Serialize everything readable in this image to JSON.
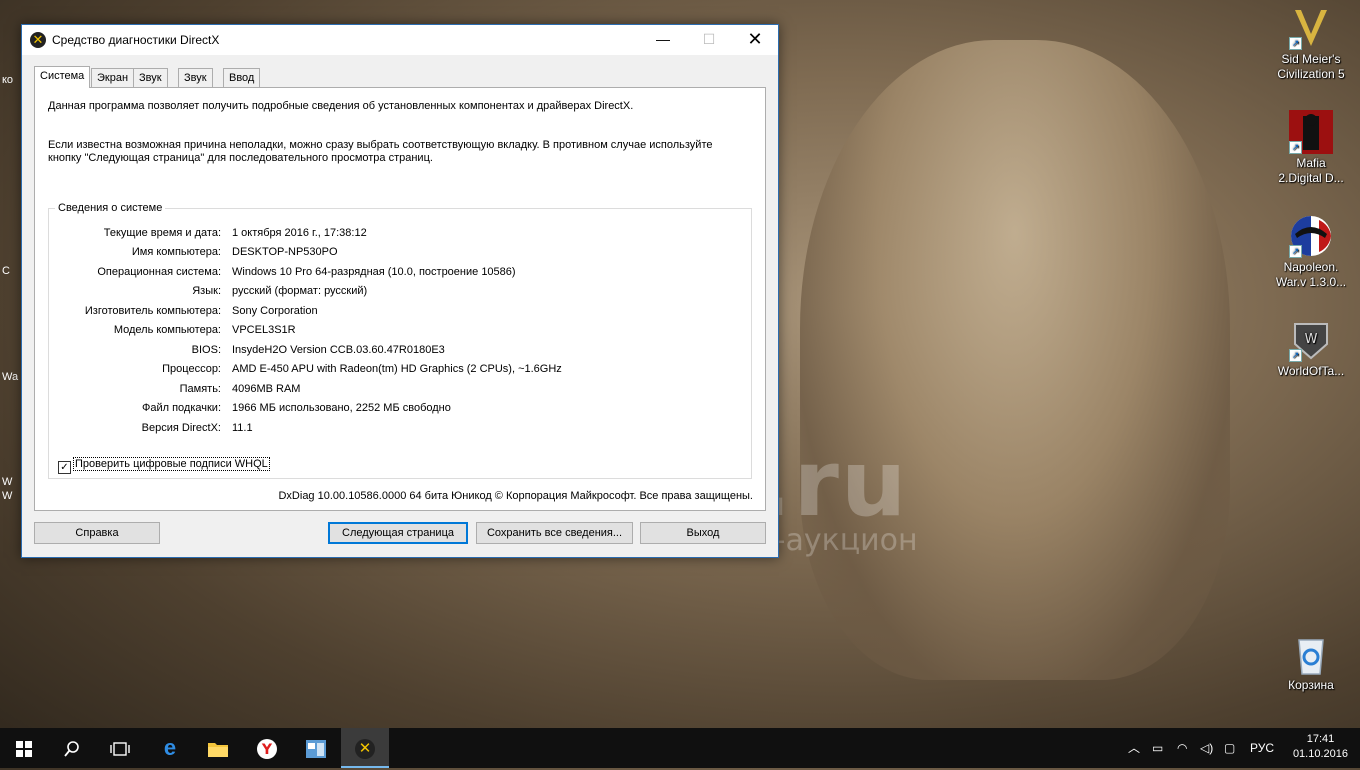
{
  "window": {
    "title": "Средство диагностики DirectX",
    "tabs": [
      "Система",
      "Экран",
      "Звук 1",
      "Звук 2",
      "Ввод"
    ],
    "active_tab": "Система",
    "intro_1": "Данная программа позволяет получить подробные сведения об установленных компонентах и драйверах DirectX.",
    "intro_2_line1": "Если известна возможная причина неполадки, можно сразу выбрать соответствующую вкладку. В противном случае используйте",
    "intro_2_line2": "кнопку \"Следующая страница\" для последовательного просмотра страниц.",
    "group_title": "Сведения о системе",
    "info": [
      {
        "label": "Текущие время и дата:",
        "value": "1 октября 2016 г., 17:38:12"
      },
      {
        "label": "Имя компьютера:",
        "value": "DESKTOP-NP530PO"
      },
      {
        "label": "Операционная система:",
        "value": "Windows 10 Pro 64-разрядная (10.0, построение 10586)"
      },
      {
        "label": "Язык:",
        "value": "русский (формат: русский)"
      },
      {
        "label": "Изготовитель компьютера:",
        "value": "Sony Corporation"
      },
      {
        "label": "Модель компьютера:",
        "value": "VPCEL3S1R"
      },
      {
        "label": "BIOS:",
        "value": "InsydeH2O Version CCB.03.60.47R0180E3"
      },
      {
        "label": "Процессор:",
        "value": "AMD E-450 APU with Radeon(tm) HD Graphics (2 CPUs), ~1.6GHz"
      },
      {
        "label": "Память:",
        "value": "4096MB RAM"
      },
      {
        "label": "Файл подкачки:",
        "value": "1966 МБ использовано, 2252 МБ свободно"
      },
      {
        "label": "Версия DirectX:",
        "value": "11.1"
      }
    ],
    "whql_checkbox": {
      "label": "Проверить цифровые подписи WHQL",
      "checked": true
    },
    "footer_note": "DxDiag 10.00.10586.0000 64 бита Юникод © Корпорация Майкрософт. Все права защищены.",
    "buttons": {
      "help": "Справка",
      "next": "Следующая страница",
      "save": "Сохранить все сведения...",
      "exit": "Выход"
    }
  },
  "desktop": {
    "watermark_big": "au.ru",
    "watermark_small": "интернет-аукцион",
    "icons": [
      {
        "label": "Sid Meier's Civilization 5"
      },
      {
        "label": "Mafia 2.Digital D..."
      },
      {
        "label": "Napoleon. War.v 1.3.0..."
      },
      {
        "label": "WorldOfTa..."
      },
      {
        "label": "Корзина"
      }
    ],
    "left_edge_text": [
      "ко",
      "С",
      "Wa",
      "W",
      "W"
    ]
  },
  "taskbar": {
    "language": "РУС",
    "time": "17:41",
    "date": "01.10.2016"
  }
}
